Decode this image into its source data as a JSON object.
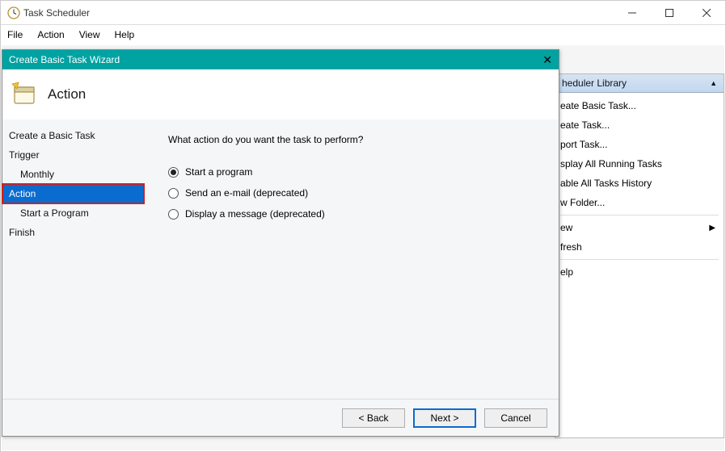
{
  "window": {
    "title": "Task Scheduler"
  },
  "menubar": {
    "file": "File",
    "action": "Action",
    "view": "View",
    "help": "Help"
  },
  "actionsPane": {
    "header": "heduler Library",
    "items": [
      "eate Basic Task...",
      "eate Task...",
      "port Task...",
      "splay All Running Tasks",
      "able All Tasks History",
      "w Folder...",
      "",
      "ew",
      "fresh",
      "",
      "elp"
    ],
    "viewHasSubmenu": true
  },
  "wizard": {
    "title": "Create Basic Task Wizard",
    "headerTitle": "Action",
    "steps": {
      "createBasic": "Create a Basic Task",
      "trigger": "Trigger",
      "monthly": "Monthly",
      "action": "Action",
      "startProgram": "Start a Program",
      "finish": "Finish"
    },
    "content": {
      "prompt": "What action do you want the task to perform?",
      "radio1": "Start a program",
      "radio2": "Send an e-mail (deprecated)",
      "radio3": "Display a message (deprecated)"
    },
    "buttons": {
      "back": "< Back",
      "next": "Next >",
      "cancel": "Cancel"
    }
  }
}
